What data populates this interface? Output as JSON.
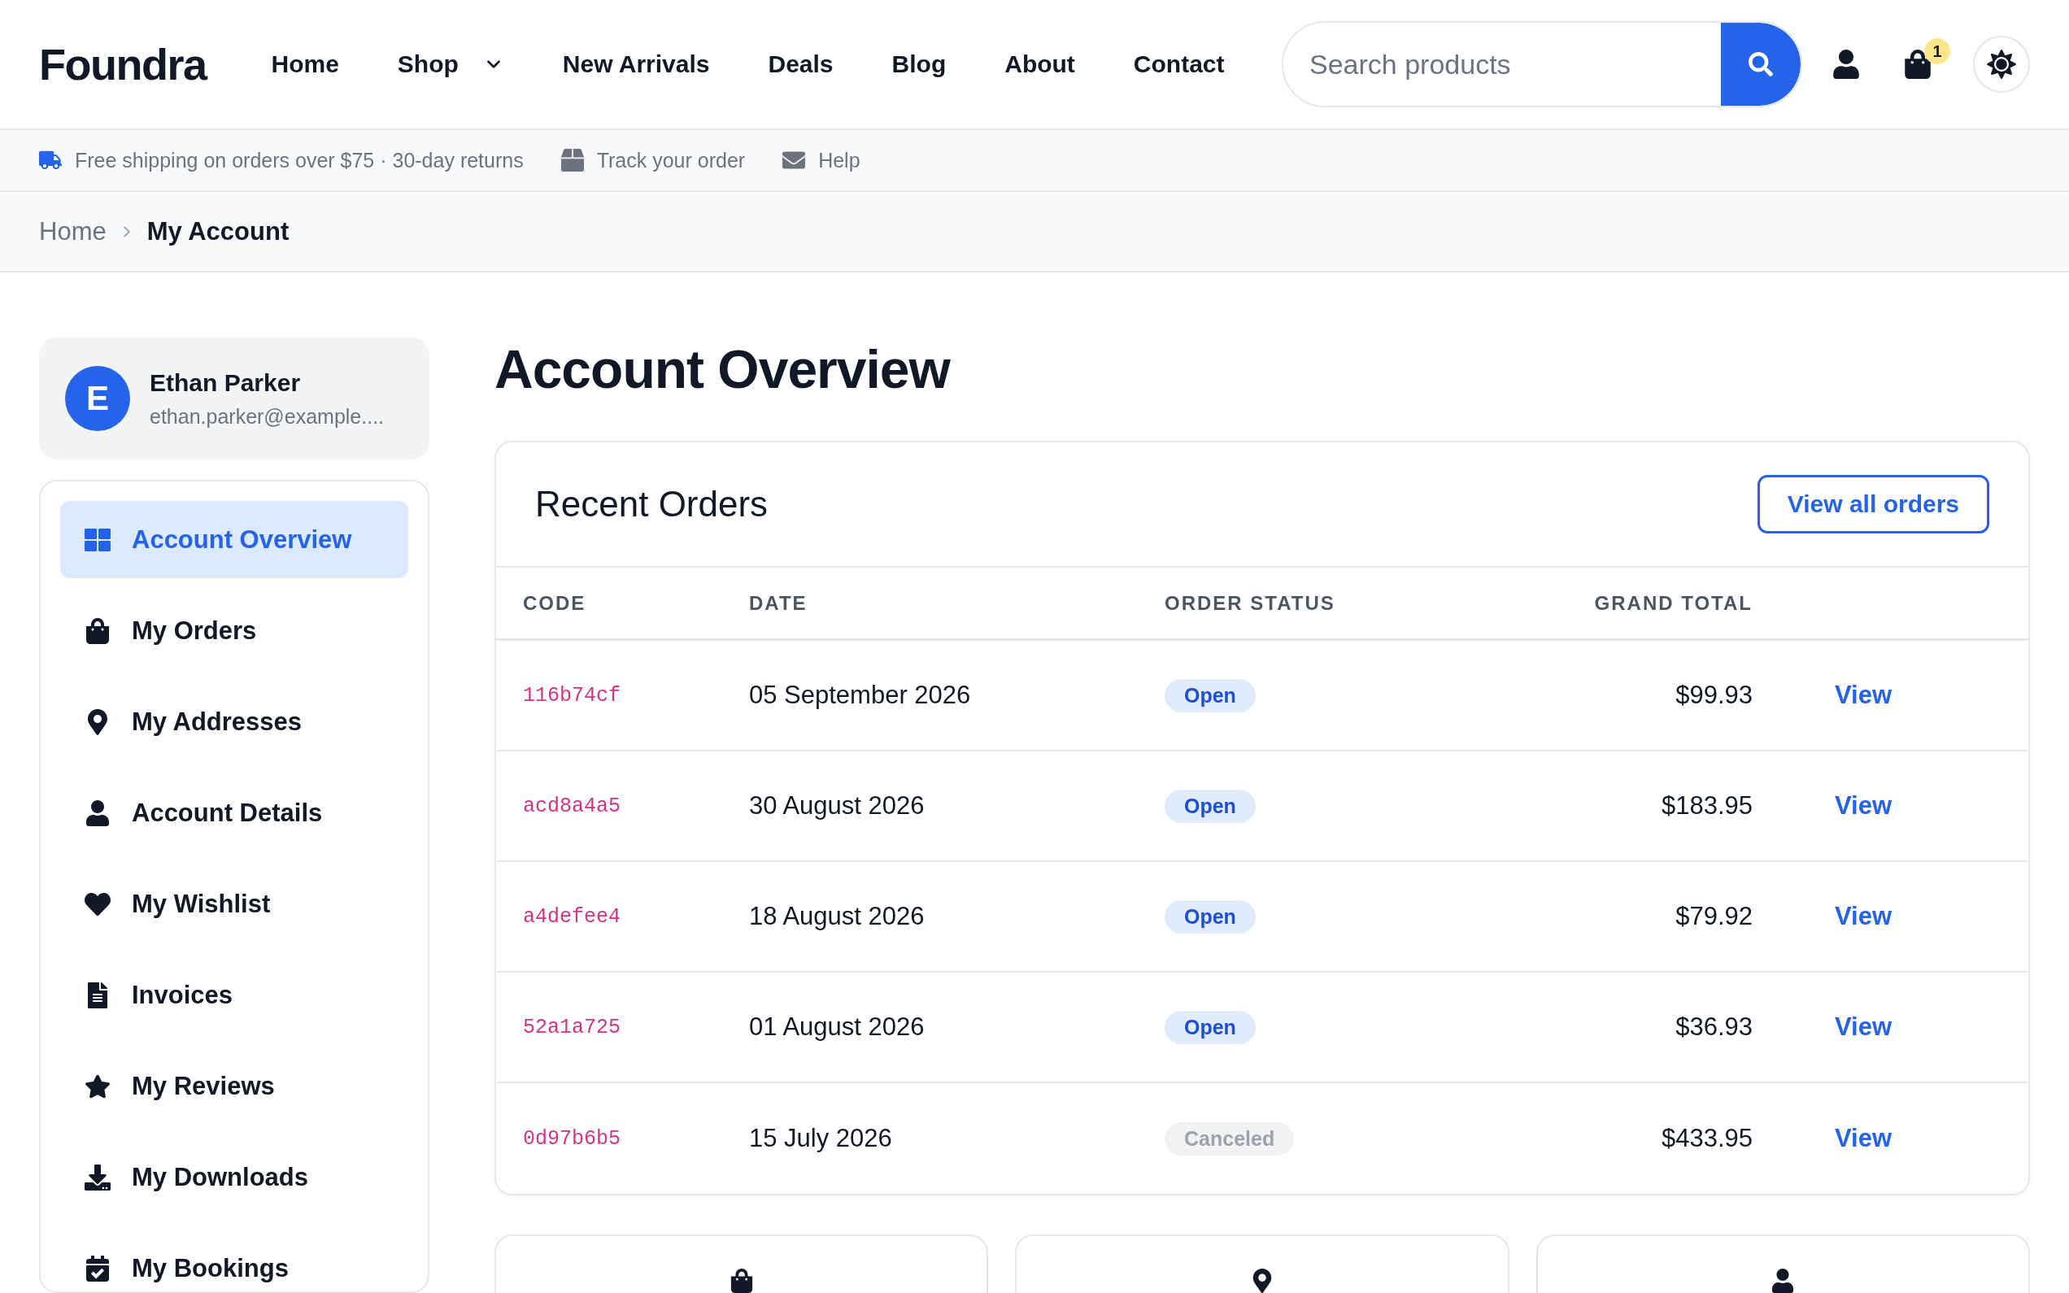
{
  "header": {
    "logo": "Foundra",
    "nav": [
      {
        "label": "Home",
        "dropdown": false
      },
      {
        "label": "Shop",
        "dropdown": true
      },
      {
        "label": "New Arrivals",
        "dropdown": false
      },
      {
        "label": "Deals",
        "dropdown": false
      },
      {
        "label": "Blog",
        "dropdown": false
      },
      {
        "label": "About",
        "dropdown": false
      },
      {
        "label": "Contact",
        "dropdown": false
      }
    ],
    "search": {
      "placeholder": "Search products"
    },
    "cart_count": "1"
  },
  "info_bar": [
    {
      "kind": "shipping",
      "text": "Free shipping on orders over $75 · 30-day returns"
    },
    {
      "kind": "track",
      "text": "Track your order"
    },
    {
      "kind": "help",
      "text": "Help"
    }
  ],
  "breadcrumb": [
    "Home",
    "My Account"
  ],
  "profile": {
    "initial": "E",
    "name": "Ethan Parker",
    "email": "ethan.parker@example...."
  },
  "sidebar": {
    "items": [
      {
        "kind": "overview",
        "label": "Account Overview",
        "selected": true
      },
      {
        "kind": "orders",
        "label": "My Orders",
        "selected": false
      },
      {
        "kind": "addresses",
        "label": "My Addresses",
        "selected": false
      },
      {
        "kind": "details",
        "label": "Account Details",
        "selected": false
      },
      {
        "kind": "wishlist",
        "label": "My Wishlist",
        "selected": false
      },
      {
        "kind": "invoices",
        "label": "Invoices",
        "selected": false
      },
      {
        "kind": "reviews",
        "label": "My Reviews",
        "selected": false
      },
      {
        "kind": "downloads",
        "label": "My Downloads",
        "selected": false
      },
      {
        "kind": "bookings",
        "label": "My Bookings",
        "selected": false
      }
    ]
  },
  "page_title": "Account Overview",
  "recent_orders": {
    "title": "Recent Orders",
    "view_all": "View all orders",
    "columns": [
      "CODE",
      "DATE",
      "ORDER STATUS",
      "GRAND TOTAL"
    ],
    "rows": [
      {
        "code": "116b74cf",
        "date": "05 September 2026",
        "status": {
          "label": "Open",
          "kind": "open"
        },
        "total": "$99.93",
        "action": "View"
      },
      {
        "code": "acd8a4a5",
        "date": "30 August 2026",
        "status": {
          "label": "Open",
          "kind": "open"
        },
        "total": "$183.95",
        "action": "View"
      },
      {
        "code": "a4defee4",
        "date": "18 August 2026",
        "status": {
          "label": "Open",
          "kind": "open"
        },
        "total": "$79.92",
        "action": "View"
      },
      {
        "code": "52a1a725",
        "date": "01 August 2026",
        "status": {
          "label": "Open",
          "kind": "open"
        },
        "total": "$36.93",
        "action": "View"
      },
      {
        "code": "0d97b6b5",
        "date": "15 July 2026",
        "status": {
          "label": "Canceled",
          "kind": "canceled"
        },
        "total": "$433.95",
        "action": "View"
      }
    ]
  },
  "summary_cards": [
    {
      "kind": "orders"
    },
    {
      "kind": "addresses"
    },
    {
      "kind": "details"
    }
  ]
}
